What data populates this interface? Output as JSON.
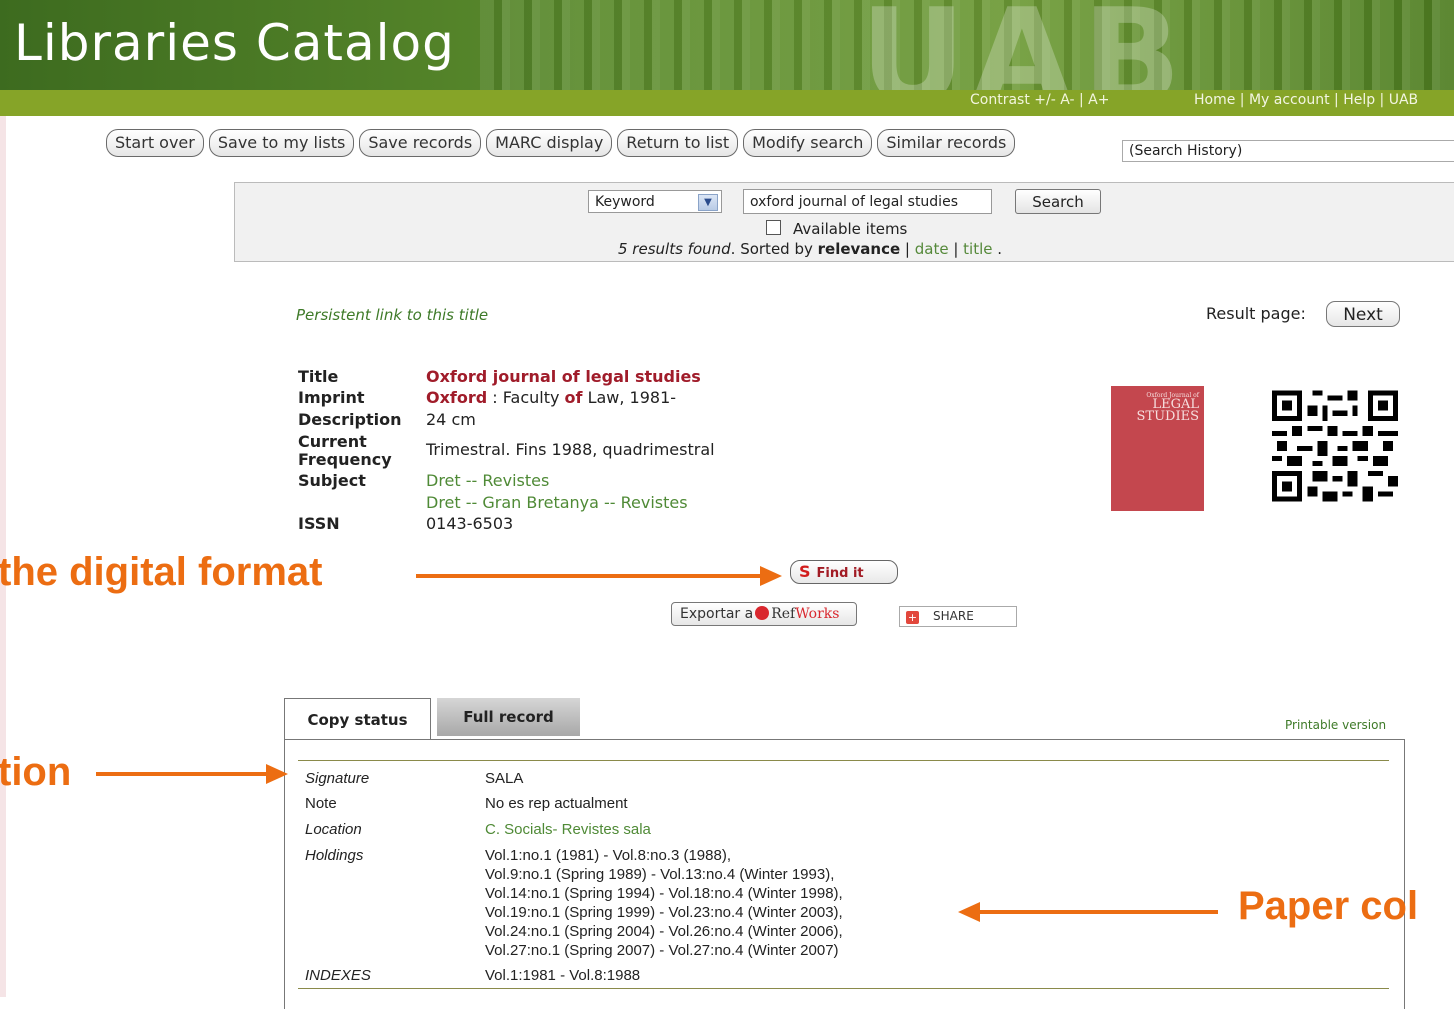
{
  "header": {
    "title": "Libraries Catalog",
    "contrast": "Contrast +/-  A- | A+",
    "links": [
      "Home",
      "My account",
      "Help",
      "UAB"
    ]
  },
  "toolbar": {
    "buttons": [
      "Start over",
      "Save to my lists",
      "Save records",
      "MARC display",
      "Return to list",
      "Modify search",
      "Similar records"
    ],
    "history_select": "(Search History)"
  },
  "search": {
    "field_select": "Keyword",
    "query": "oxford journal of legal studies",
    "button": "Search",
    "available_items": "Available items",
    "results_count": "5 results found",
    "sorted_by": ". Sorted by ",
    "sort_relevance": "relevance",
    "sort_date": "date",
    "sort_title": "title",
    "sep": " | ",
    "period": " ."
  },
  "persistent_link": "Persistent link to this title",
  "result_page": {
    "label": "Result page:",
    "next": "Next"
  },
  "record": {
    "title_label": "Title",
    "title_value": "Oxford journal of legal studies",
    "imprint_label": "Imprint",
    "imprint_place": "Oxford",
    "imprint_sep": " : Faculty ",
    "imprint_of": "of",
    "imprint_rest": " Law, 1981-",
    "description_label": "Description",
    "description_value": "24 cm",
    "frequency_label_1": "Current",
    "frequency_label_2": "Frequency",
    "frequency_value": "Trimestral. Fins 1988, quadrimestral",
    "subject_label": "Subject",
    "subjects": [
      "Dret -- Revistes",
      "Dret -- Gran Bretanya -- Revistes"
    ],
    "issn_label": "ISSN",
    "issn_value": "0143-6503"
  },
  "cover": {
    "line1": "Oxford Journal of",
    "line2": "LEGAL",
    "line3": "STUDIES"
  },
  "actions": {
    "find_it": "Find it",
    "export": "Exportar a",
    "refworks_ref": "Ref",
    "refworks_works": "Works",
    "share": "SHARE"
  },
  "annotations": {
    "digital": "the digital format",
    "location": "tion",
    "paper": "Paper col"
  },
  "tabs": {
    "copy_status": "Copy status",
    "full_record": "Full record",
    "printable": "Printable version"
  },
  "holdings": {
    "signature_label": "Signature",
    "signature_value": "SALA",
    "note_label": "Note",
    "note_value": "No es rep actualment",
    "location_label": "Location",
    "location_value": "C. Socials- Revistes sala",
    "holdings_label": "Holdings",
    "holdings_lines": [
      "Vol.1:no.1 (1981) - Vol.8:no.3 (1988),",
      "Vol.9:no.1 (Spring 1989) - Vol.13:no.4 (Winter 1993),",
      "Vol.14:no.1 (Spring 1994) - Vol.18:no.4 (Winter 1998),",
      "Vol.19:no.1 (Spring 1999) - Vol.23:no.4 (Winter 2003),",
      "Vol.24:no.1 (Spring 2004) - Vol.26:no.4 (Winter 2006),",
      "Vol.27:no.1 (Spring 2007) - Vol.27:no.4 (Winter 2007)"
    ],
    "indexes_label": "INDEXES",
    "indexes_value": "Vol.1:1981 - Vol.8:1988"
  },
  "colors": {
    "accent_orange": "#ec6d12",
    "title_red": "#a01c2a",
    "link_green": "#4f8a36",
    "bar_green": "#86a428"
  }
}
